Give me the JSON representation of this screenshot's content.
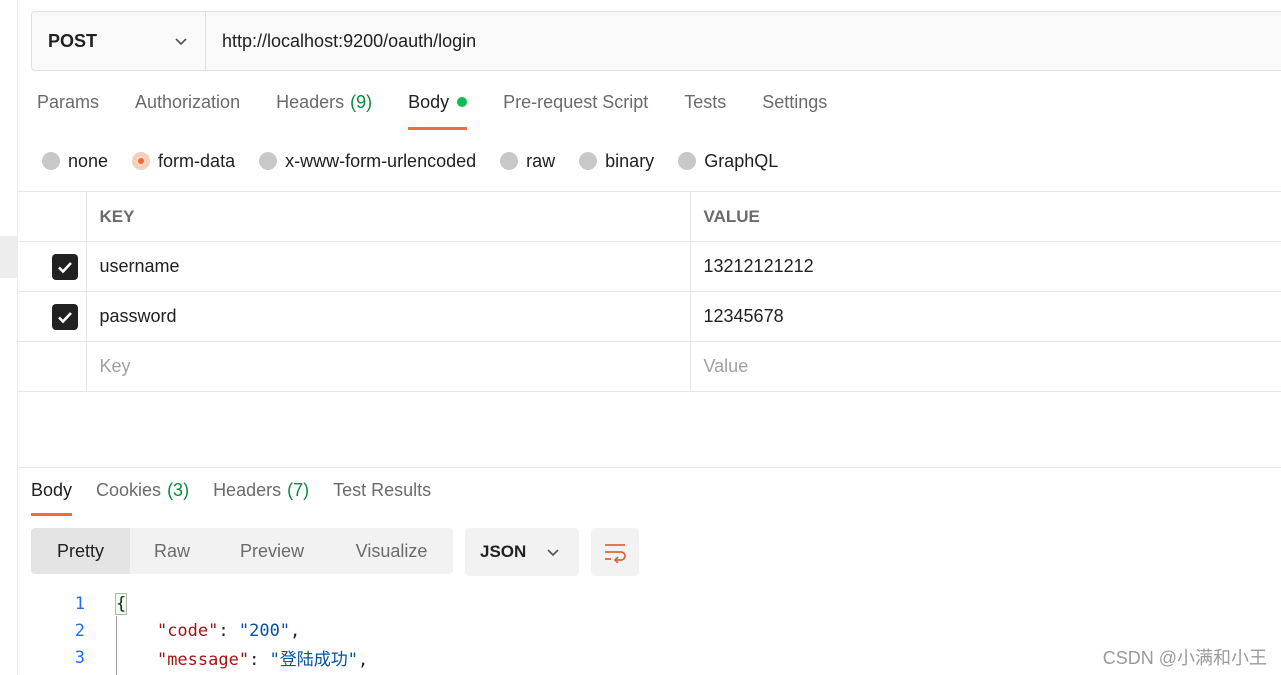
{
  "request": {
    "method": "POST",
    "url": "http://localhost:9200/oauth/login",
    "tabs": [
      {
        "label": "Params",
        "count": ""
      },
      {
        "label": "Authorization",
        "count": ""
      },
      {
        "label": "Headers",
        "count": "(9)"
      },
      {
        "label": "Body",
        "count": ""
      },
      {
        "label": "Pre-request Script",
        "count": ""
      },
      {
        "label": "Tests",
        "count": ""
      },
      {
        "label": "Settings",
        "count": ""
      }
    ],
    "body_types": [
      "none",
      "form-data",
      "x-www-form-urlencoded",
      "raw",
      "binary",
      "GraphQL"
    ],
    "selected_body_type": "form-data",
    "table": {
      "headers": {
        "key": "KEY",
        "value": "VALUE"
      },
      "rows": [
        {
          "key": "username",
          "value": "13212121212",
          "checked": true
        },
        {
          "key": "password",
          "value": "12345678",
          "checked": true
        }
      ],
      "placeholder_key": "Key",
      "placeholder_value": "Value"
    }
  },
  "response": {
    "tabs": [
      {
        "label": "Body",
        "count": ""
      },
      {
        "label": "Cookies",
        "count": "(3)"
      },
      {
        "label": "Headers",
        "count": "(7)"
      },
      {
        "label": "Test Results",
        "count": ""
      }
    ],
    "views": [
      "Pretty",
      "Raw",
      "Preview",
      "Visualize"
    ],
    "format": "JSON",
    "code_lines": [
      {
        "n": "1",
        "brace": "{"
      },
      {
        "n": "2",
        "key": "\"code\"",
        "sep": ": ",
        "val": "\"200\"",
        "end": ","
      },
      {
        "n": "3",
        "key": "\"message\"",
        "sep": ": ",
        "val": "\"登陆成功\"",
        "end": ","
      }
    ]
  },
  "watermark": "CSDN @小满和小王",
  "colors": {
    "accent": "#f26b3a",
    "success": "#0cbb52",
    "count_green": "#0b8a3e"
  }
}
